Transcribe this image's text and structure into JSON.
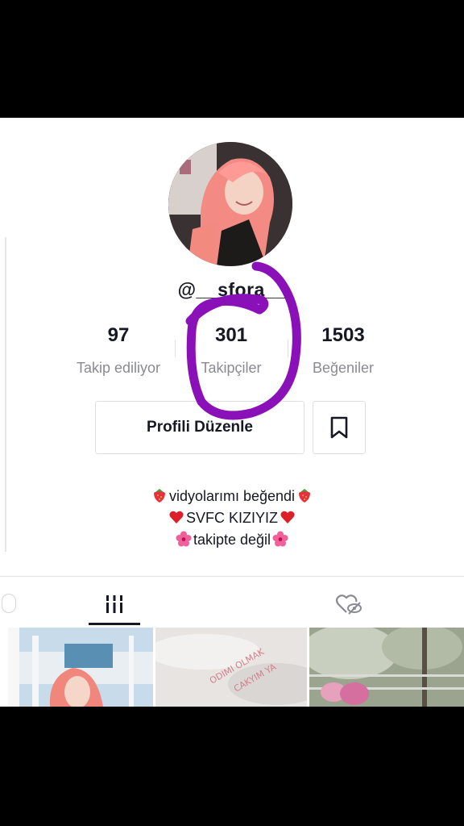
{
  "profile": {
    "username": "@__sfora__",
    "stats": [
      {
        "value": "97",
        "label": "Takip ediliyor"
      },
      {
        "value": "301",
        "label": "Takipçiler"
      },
      {
        "value": "1503",
        "label": "Beğeniler"
      }
    ],
    "edit_button_label": "Profili Düzenle",
    "bio": [
      {
        "text": "vidyolarımı beğendi",
        "emoji_left": "strawberry",
        "emoji_right": "strawberry"
      },
      {
        "text": "SVFC KIZIYIZ",
        "emoji_left": "red-heart",
        "emoji_right": "red-heart"
      },
      {
        "text": "takipte değil",
        "emoji_left": "hibiscus",
        "emoji_right": "hibiscus"
      }
    ]
  },
  "tabs": [
    {
      "name": "videos",
      "icon": "grid-icon",
      "active": true
    },
    {
      "name": "liked",
      "icon": "heart-eye-off-icon",
      "active": false
    }
  ],
  "video_thumbnails": [
    {
      "description_icon": "person-pink-hair"
    },
    {
      "overlay_text": "ODIMI OLMAK ... CAKYIM YA"
    },
    {
      "description_icon": "flowering-tree"
    }
  ],
  "annotation": {
    "color": "#8a10b8"
  },
  "colors": {
    "text": "#161823",
    "secondary": "#8a8b91",
    "border": "#dedede"
  }
}
